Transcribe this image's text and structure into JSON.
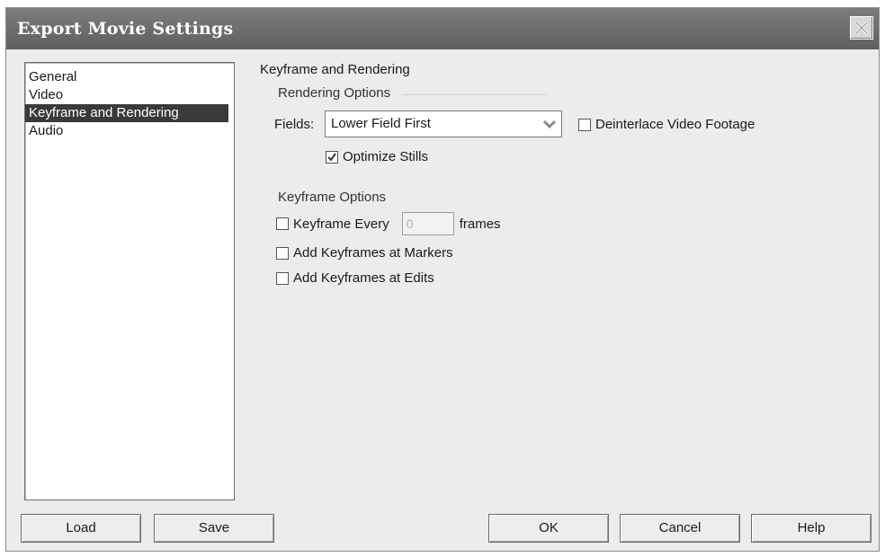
{
  "window": {
    "title": "Export Movie Settings",
    "close_icon": "close-icon"
  },
  "categories": [
    {
      "label": "General",
      "selected": false
    },
    {
      "label": "Video",
      "selected": false
    },
    {
      "label": "Keyframe and Rendering",
      "selected": true
    },
    {
      "label": "Audio",
      "selected": false
    }
  ],
  "section_title": "Keyframe and Rendering",
  "rendering": {
    "group_label": "Rendering Options",
    "fields_label": "Fields:",
    "fields_value": "Lower Field First",
    "deinterlace_label": "Deinterlace Video Footage",
    "deinterlace_checked": false,
    "optimize_label": "Optimize Stills",
    "optimize_checked": true
  },
  "keyframe": {
    "group_label": "Keyframe Options",
    "every_label": "Keyframe Every",
    "every_checked": false,
    "every_value": "0",
    "frames_label": "frames",
    "markers_label": "Add Keyframes at Markers",
    "markers_checked": false,
    "edits_label": "Add Keyframes at Edits",
    "edits_checked": false
  },
  "buttons": {
    "load": "Load",
    "save": "Save",
    "ok": "OK",
    "cancel": "Cancel",
    "help": "Help"
  }
}
